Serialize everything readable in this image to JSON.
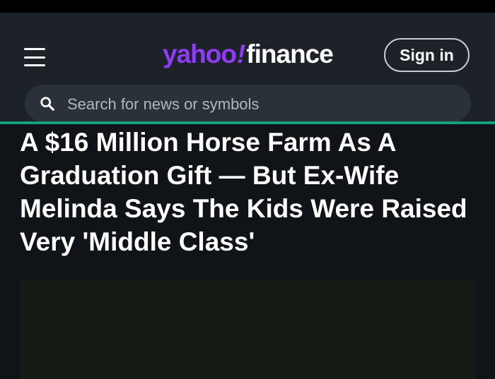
{
  "header": {
    "logo": {
      "brand": "yahoo",
      "bang": "!",
      "product": "finance",
      "brand_color": "#8f3cf8"
    },
    "sign_in_label": "Sign in",
    "menu_icon": "hamburger-menu-icon"
  },
  "search": {
    "placeholder": "Search for news or symbols",
    "icon": "search-icon"
  },
  "article": {
    "headline": "A $16 Million Horse Farm As A Graduation Gift — But Ex-Wife Melinda Says The Kids Were Raised Very 'Middle Class'"
  },
  "colors": {
    "background": "#101418",
    "header_background": "#1d2228",
    "accent": "#14a07a",
    "search_background": "#2b3138"
  }
}
